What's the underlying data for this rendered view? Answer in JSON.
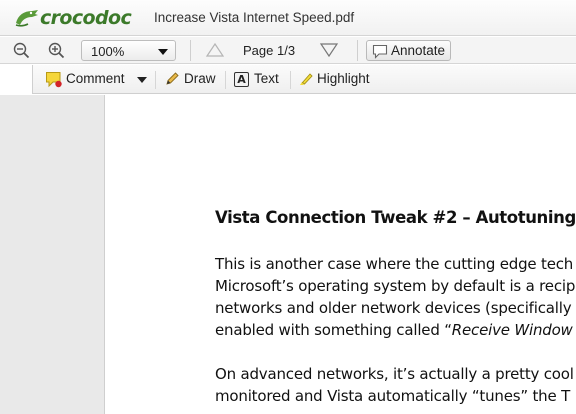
{
  "app": {
    "logo_text": "crocodoc",
    "document_title": "Increase Vista Internet Speed.pdf"
  },
  "toolbar": {
    "zoom_out_icon": "zoom-out-icon",
    "zoom_in_icon": "zoom-in-icon",
    "zoom_value": "100%",
    "page_indicator": "Page 1/3",
    "prev_icon": "triangle-up-icon",
    "next_icon": "triangle-down-icon",
    "annotate_label": "Annotate"
  },
  "annotate_bar": {
    "comment_label": "Comment",
    "draw_label": "Draw",
    "text_label": "Text",
    "text_icon_glyph": "A",
    "highlight_label": "Highlight"
  },
  "document": {
    "heading": "Vista Connection Tweak #2 – Autotuning",
    "paragraph1": [
      "This is another case where the cutting edge tech",
      "Microsoft’s operating system by default is a recip",
      "networks and older network devices (specifically",
      {
        "before": "enabled with something called “",
        "italic": "Receive Window"
      }
    ],
    "paragraph2": [
      "On advanced networks, it’s actually a pretty cool",
      "monitored and Vista automatically “tunes” the T"
    ]
  },
  "colors": {
    "logo_green": "#3c7a2a",
    "toolbar_bg": "#f4f4f4",
    "viewer_bg": "#e9e9e9",
    "page_bg": "#ffffff"
  }
}
